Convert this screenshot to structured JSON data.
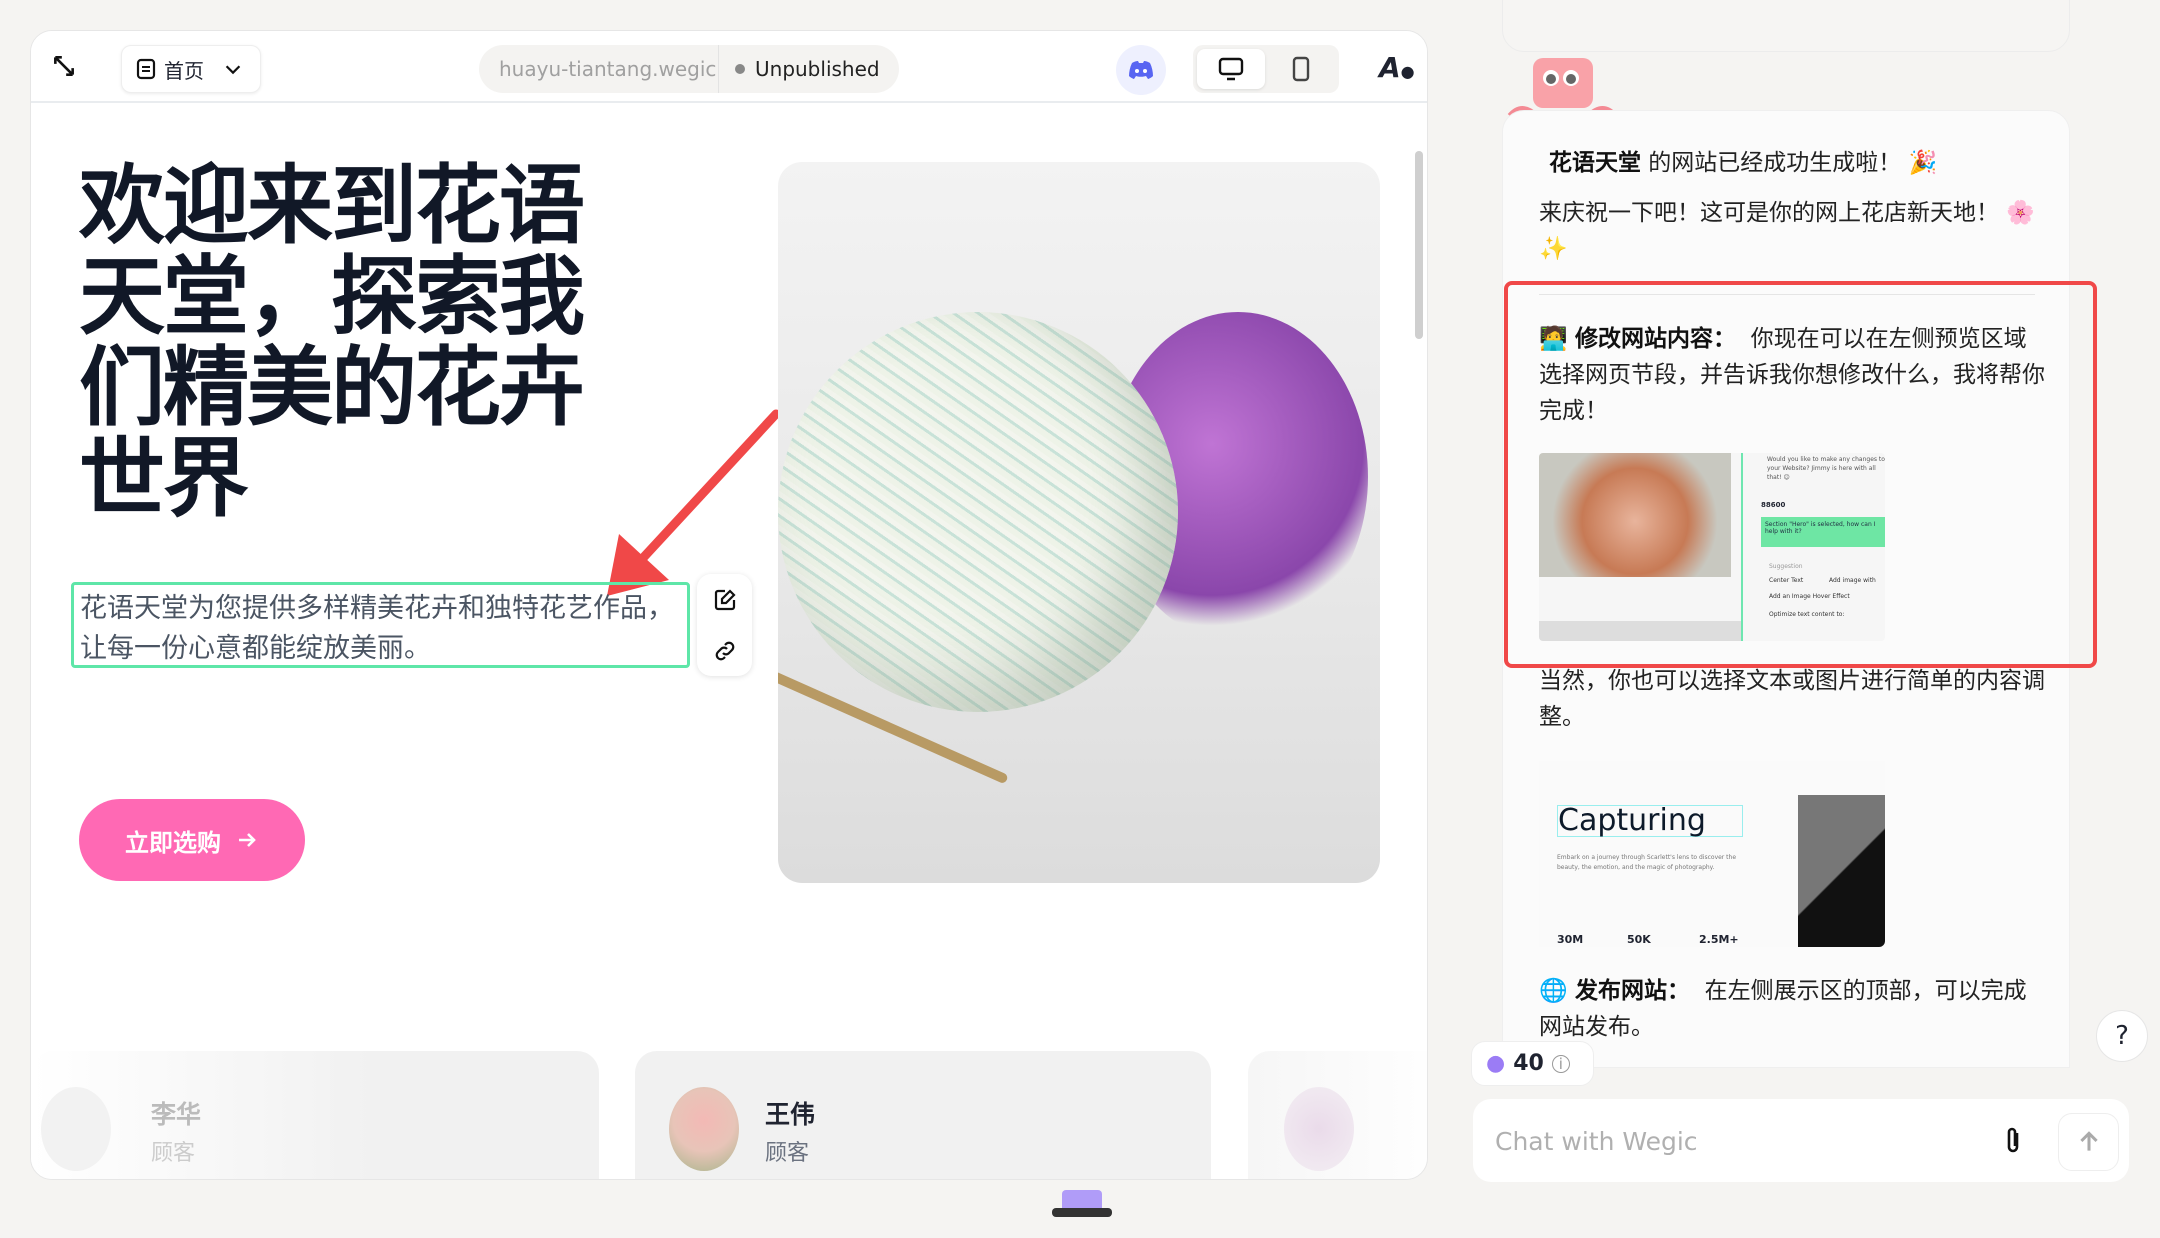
{
  "toolbar": {
    "page_label": "首页",
    "url": "huayu-tiantang.wegic.ai",
    "status": "Unpublished"
  },
  "hero": {
    "title": "欢迎来到花语天堂，探索我们精美的花卉世界",
    "description": "花语天堂为您提供多样精美花卉和独特花艺作品，让每一份心意都能绽放美丽。",
    "cta_label": "立即选购",
    "cta_icon": "arrow-right-icon"
  },
  "testimonials": [
    {
      "name": "李华",
      "role": "顾客"
    },
    {
      "name": "王伟",
      "role": "顾客"
    },
    {
      "name": "",
      "role": ""
    }
  ],
  "chat": {
    "line1_bold": "花语天堂",
    "line1_rest": " 的网站已经成功生成啦！ 🎉",
    "line2": "来庆祝一下吧！这可是你的网上花店新天地！ 🌸 ✨",
    "edit_title": "修改网站内容：",
    "edit_text": "你现在可以在左侧预览区域选择网页节段，并告诉我你想修改什么，我将帮你完成！",
    "demo1": {
      "credits": "88600",
      "selected_msg": "Section \"Hero\" is selected, how can I help with it?",
      "suggestion": "Suggestion",
      "chips": [
        "Center Text",
        "Add image with",
        "Add an Image Hover Effect",
        "Optimize text content to:"
      ],
      "bot_msg": "Would you like to make any changes to your Website? Jimmy is here with all that! 😊"
    },
    "adjust_text": "当然，你也可以选择文本或图片进行简单的内容调整。",
    "demo2": {
      "heading": "Capturing",
      "body": "Embark on a journey through Scarlett's lens to discover the beauty, the emotion, and the magic of photography.",
      "stats": [
        "30M",
        "50K",
        "2.5M+"
      ]
    },
    "publish_title": "发布网站：",
    "publish_text": "在左侧展示区的顶部，可以完成网站发布。",
    "credits": "40",
    "help": "?",
    "input_placeholder": "Chat with Wegic"
  },
  "colors": {
    "accent_pink": "#ff69b4",
    "selection_green": "#5ee6a8",
    "annotation_red": "#f04848",
    "discord": "#5865f2"
  }
}
